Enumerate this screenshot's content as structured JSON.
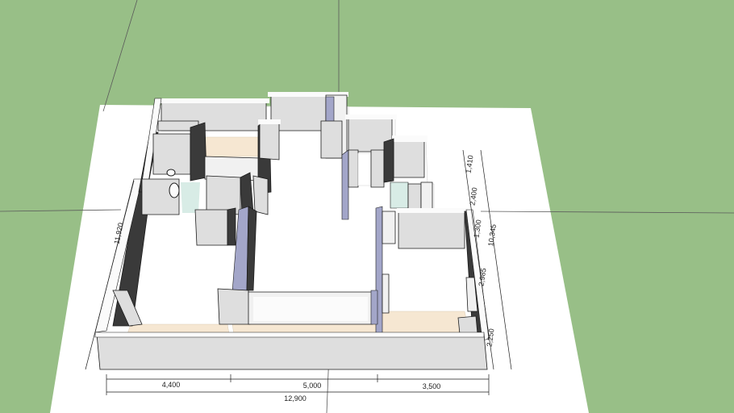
{
  "scene": {
    "colors": {
      "ground": "#98bf87",
      "paper": "#ffffff",
      "wall_face": "#dedede",
      "wall_light": "#f1f1f1",
      "wall_shadow": "#3a3a3a",
      "wall_top": "#fbfbfb",
      "glass": "#a3a6c9",
      "tile": "#f6e7d2",
      "outline": "#1c1c1c",
      "axis": "#5a5a5a"
    },
    "dimensions": {
      "bottom_segments": [
        "4,400",
        "5,000",
        "3,500"
      ],
      "bottom_total": "12,900",
      "right_segments": [
        "1,410",
        "2,400",
        "1,300",
        "2,985",
        "2,250"
      ],
      "right_total": "10,345",
      "left_total": "11,920"
    }
  }
}
